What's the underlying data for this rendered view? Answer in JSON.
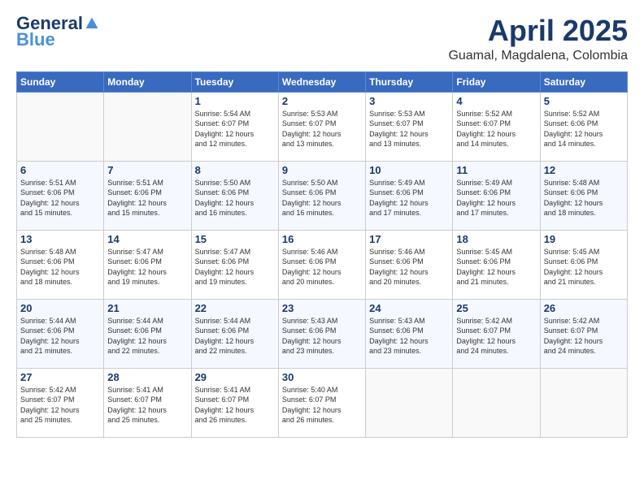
{
  "header": {
    "logo_general": "General",
    "logo_blue": "Blue",
    "month": "April 2025",
    "location": "Guamal, Magdalena, Colombia"
  },
  "days_of_week": [
    "Sunday",
    "Monday",
    "Tuesday",
    "Wednesday",
    "Thursday",
    "Friday",
    "Saturday"
  ],
  "weeks": [
    [
      {
        "day": "",
        "info": ""
      },
      {
        "day": "",
        "info": ""
      },
      {
        "day": "1",
        "info": "Sunrise: 5:54 AM\nSunset: 6:07 PM\nDaylight: 12 hours\nand 12 minutes."
      },
      {
        "day": "2",
        "info": "Sunrise: 5:53 AM\nSunset: 6:07 PM\nDaylight: 12 hours\nand 13 minutes."
      },
      {
        "day": "3",
        "info": "Sunrise: 5:53 AM\nSunset: 6:07 PM\nDaylight: 12 hours\nand 13 minutes."
      },
      {
        "day": "4",
        "info": "Sunrise: 5:52 AM\nSunset: 6:07 PM\nDaylight: 12 hours\nand 14 minutes."
      },
      {
        "day": "5",
        "info": "Sunrise: 5:52 AM\nSunset: 6:06 PM\nDaylight: 12 hours\nand 14 minutes."
      }
    ],
    [
      {
        "day": "6",
        "info": "Sunrise: 5:51 AM\nSunset: 6:06 PM\nDaylight: 12 hours\nand 15 minutes."
      },
      {
        "day": "7",
        "info": "Sunrise: 5:51 AM\nSunset: 6:06 PM\nDaylight: 12 hours\nand 15 minutes."
      },
      {
        "day": "8",
        "info": "Sunrise: 5:50 AM\nSunset: 6:06 PM\nDaylight: 12 hours\nand 16 minutes."
      },
      {
        "day": "9",
        "info": "Sunrise: 5:50 AM\nSunset: 6:06 PM\nDaylight: 12 hours\nand 16 minutes."
      },
      {
        "day": "10",
        "info": "Sunrise: 5:49 AM\nSunset: 6:06 PM\nDaylight: 12 hours\nand 17 minutes."
      },
      {
        "day": "11",
        "info": "Sunrise: 5:49 AM\nSunset: 6:06 PM\nDaylight: 12 hours\nand 17 minutes."
      },
      {
        "day": "12",
        "info": "Sunrise: 5:48 AM\nSunset: 6:06 PM\nDaylight: 12 hours\nand 18 minutes."
      }
    ],
    [
      {
        "day": "13",
        "info": "Sunrise: 5:48 AM\nSunset: 6:06 PM\nDaylight: 12 hours\nand 18 minutes."
      },
      {
        "day": "14",
        "info": "Sunrise: 5:47 AM\nSunset: 6:06 PM\nDaylight: 12 hours\nand 19 minutes."
      },
      {
        "day": "15",
        "info": "Sunrise: 5:47 AM\nSunset: 6:06 PM\nDaylight: 12 hours\nand 19 minutes."
      },
      {
        "day": "16",
        "info": "Sunrise: 5:46 AM\nSunset: 6:06 PM\nDaylight: 12 hours\nand 20 minutes."
      },
      {
        "day": "17",
        "info": "Sunrise: 5:46 AM\nSunset: 6:06 PM\nDaylight: 12 hours\nand 20 minutes."
      },
      {
        "day": "18",
        "info": "Sunrise: 5:45 AM\nSunset: 6:06 PM\nDaylight: 12 hours\nand 21 minutes."
      },
      {
        "day": "19",
        "info": "Sunrise: 5:45 AM\nSunset: 6:06 PM\nDaylight: 12 hours\nand 21 minutes."
      }
    ],
    [
      {
        "day": "20",
        "info": "Sunrise: 5:44 AM\nSunset: 6:06 PM\nDaylight: 12 hours\nand 21 minutes."
      },
      {
        "day": "21",
        "info": "Sunrise: 5:44 AM\nSunset: 6:06 PM\nDaylight: 12 hours\nand 22 minutes."
      },
      {
        "day": "22",
        "info": "Sunrise: 5:44 AM\nSunset: 6:06 PM\nDaylight: 12 hours\nand 22 minutes."
      },
      {
        "day": "23",
        "info": "Sunrise: 5:43 AM\nSunset: 6:06 PM\nDaylight: 12 hours\nand 23 minutes."
      },
      {
        "day": "24",
        "info": "Sunrise: 5:43 AM\nSunset: 6:06 PM\nDaylight: 12 hours\nand 23 minutes."
      },
      {
        "day": "25",
        "info": "Sunrise: 5:42 AM\nSunset: 6:07 PM\nDaylight: 12 hours\nand 24 minutes."
      },
      {
        "day": "26",
        "info": "Sunrise: 5:42 AM\nSunset: 6:07 PM\nDaylight: 12 hours\nand 24 minutes."
      }
    ],
    [
      {
        "day": "27",
        "info": "Sunrise: 5:42 AM\nSunset: 6:07 PM\nDaylight: 12 hours\nand 25 minutes."
      },
      {
        "day": "28",
        "info": "Sunrise: 5:41 AM\nSunset: 6:07 PM\nDaylight: 12 hours\nand 25 minutes."
      },
      {
        "day": "29",
        "info": "Sunrise: 5:41 AM\nSunset: 6:07 PM\nDaylight: 12 hours\nand 26 minutes."
      },
      {
        "day": "30",
        "info": "Sunrise: 5:40 AM\nSunset: 6:07 PM\nDaylight: 12 hours\nand 26 minutes."
      },
      {
        "day": "",
        "info": ""
      },
      {
        "day": "",
        "info": ""
      },
      {
        "day": "",
        "info": ""
      }
    ]
  ]
}
